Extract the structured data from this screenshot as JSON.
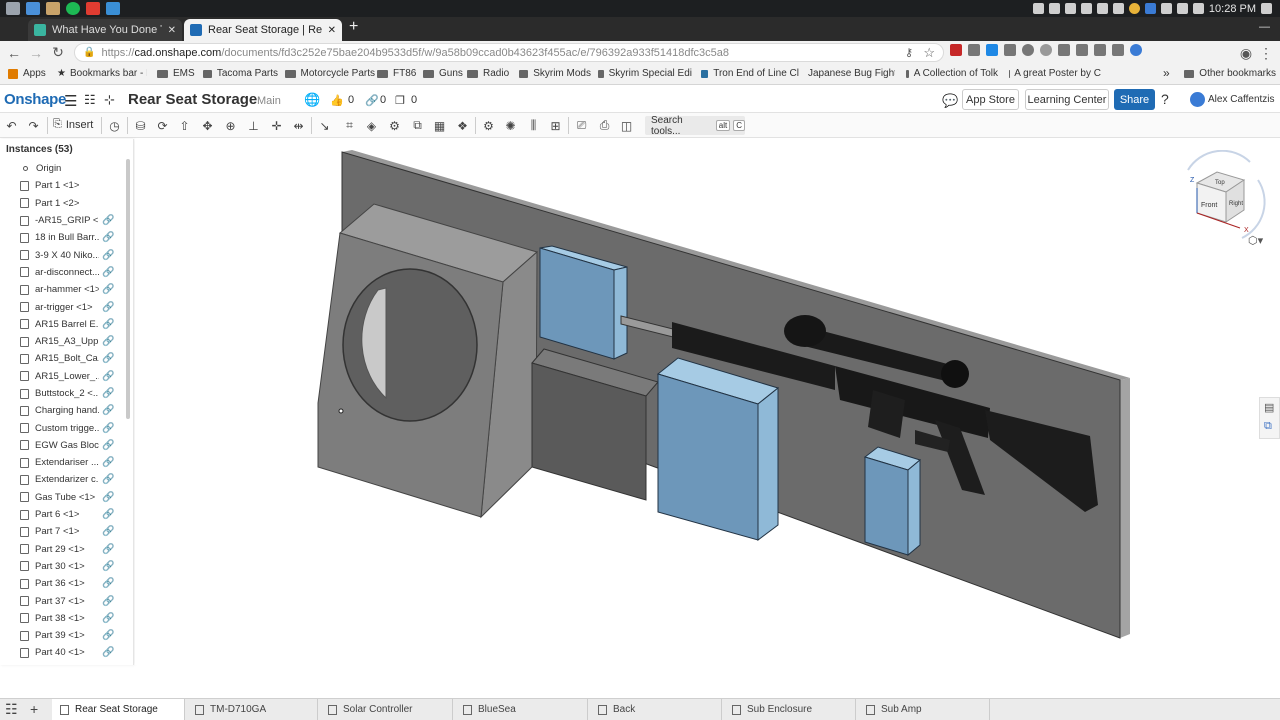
{
  "system": {
    "time": "10:28 PM"
  },
  "browser": {
    "tabs": [
      {
        "title": "What Have You Done To Your",
        "active": false
      },
      {
        "title": "Rear Seat Storage | Rear Seat",
        "active": true
      }
    ],
    "url_prefix": "https://",
    "url_host": "cad.onshape.com",
    "url_path": "/documents/fd3c252e75bae204b9533d5f/w/9a58b09ccad0b43623f455ac/e/796392a933f51418dfc3c5a8",
    "bookmarks": [
      "Apps",
      "Bookmarks bar - B",
      "EMS",
      "Tacoma Parts",
      "Motorcycle Parts",
      "FT86",
      "Guns",
      "Radio",
      "Skyrim Mods",
      "Skyrim Special Edi",
      "Tron End of Line Cl",
      "Japanese Bug Fight",
      "A Collection of Tolk",
      "A great Poster by C",
      "»",
      "Other bookmarks"
    ]
  },
  "onshape": {
    "logo": "Onshape",
    "doc_title": "Rear Seat Storage",
    "workspace": "Main",
    "likes": "0",
    "links": "0",
    "copies": "0",
    "app_store": "App Store",
    "learning_center": "Learning Center",
    "share": "Share",
    "help": "?",
    "user": "Alex Caffentzis",
    "insert_label": "Insert",
    "search_tools": "Search tools...",
    "search_kbd_1": "alt",
    "search_kbd_2": "C"
  },
  "instances": {
    "header": "Instances (53)",
    "items": [
      "Origin",
      "Part 1 <1>",
      "Part 1 <2>",
      "-AR15_GRIP <...",
      "18 in Bull Barr...",
      "3-9 X 40 Niko...",
      "ar-disconnect...",
      "ar-hammer <1>",
      "ar-trigger <1>",
      "AR15 Barrel E...",
      "AR15_A3_Upp...",
      "AR15_Bolt_Ca...",
      "AR15_Lower_...",
      "Buttstock_2 <...",
      "Charging hand...",
      "Custom trigge...",
      "EGW Gas Bloc...",
      "Extendariser ...",
      "Extendarizer c...",
      "Gas Tube <1>",
      "Part 6 <1>",
      "Part 7 <1>",
      "Part 29 <1>",
      "Part 30 <1>",
      "Part 36 <1>",
      "Part 37 <1>",
      "Part 38 <1>",
      "Part 39 <1>",
      "Part 40 <1>"
    ]
  },
  "viewcube": {
    "top": "Top",
    "front": "Front",
    "right": "Right",
    "z": "Z",
    "x": "X"
  },
  "bottom_tabs": [
    {
      "label": "Rear Seat Storage",
      "active": true
    },
    {
      "label": "TM-D710GA",
      "active": false
    },
    {
      "label": "Solar Controller",
      "active": false
    },
    {
      "label": "BlueSea",
      "active": false
    },
    {
      "label": "Back",
      "active": false
    },
    {
      "label": "Sub Enclosure",
      "active": false
    },
    {
      "label": "Sub Amp",
      "active": false
    }
  ],
  "colors": {
    "brand": "#1f6bb4",
    "part_blue": "#6d97ba",
    "panel_gray": "#6b6b6b"
  }
}
